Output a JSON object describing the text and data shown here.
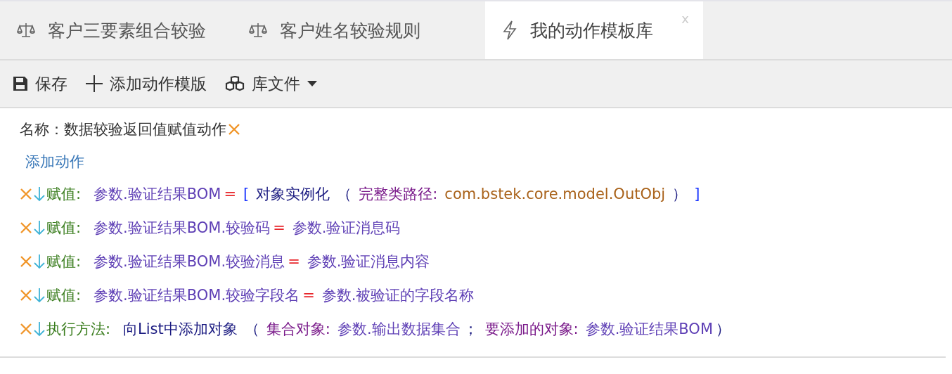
{
  "tabs": [
    {
      "kind": "scale",
      "label": "客户三要素组合较验",
      "selected": false
    },
    {
      "kind": "scale",
      "label": "客户姓名较验规则",
      "selected": false
    },
    {
      "kind": "bolt",
      "label": "我的动作模板库",
      "selected": true,
      "close": "x"
    }
  ],
  "toolbar": [
    {
      "kind": "save",
      "label": "保存"
    },
    {
      "kind": "plus",
      "label": "添加动作模版"
    },
    {
      "kind": "cubes",
      "label": "库文件",
      "dropdown": true
    }
  ],
  "name": {
    "label": "名称：",
    "value": "数据较验返回值赋值动作"
  },
  "add_action": "添加动作",
  "actions": [
    {
      "tokens": [
        {
          "kind": "label",
          "text": "赋值:"
        },
        {
          "kind": "var",
          "text": "参数.验证结果BOM"
        },
        {
          "kind": "eq",
          "text": "="
        },
        {
          "kind": "bracket",
          "text": "["
        },
        {
          "kind": "method",
          "text": "对象实例化"
        },
        {
          "kind": "paren",
          "text": "（"
        },
        {
          "kind": "param",
          "text": "完整类路径:"
        },
        {
          "kind": "value",
          "text": "com.bstek.core.model.OutObj"
        },
        {
          "kind": "paren",
          "text": "）"
        },
        {
          "kind": "bracket",
          "text": "]"
        }
      ]
    },
    {
      "tokens": [
        {
          "kind": "label",
          "text": "赋值:"
        },
        {
          "kind": "var",
          "text": "参数.验证结果BOM.较验码"
        },
        {
          "kind": "eq",
          "text": "="
        },
        {
          "kind": "var",
          "text": "参数.验证消息码"
        }
      ]
    },
    {
      "tokens": [
        {
          "kind": "label",
          "text": "赋值:"
        },
        {
          "kind": "var",
          "text": "参数.验证结果BOM.较验消息"
        },
        {
          "kind": "eq",
          "text": "="
        },
        {
          "kind": "var",
          "text": "参数.验证消息内容"
        }
      ]
    },
    {
      "tokens": [
        {
          "kind": "label",
          "text": "赋值:"
        },
        {
          "kind": "var",
          "text": "参数.验证结果BOM.较验字段名"
        },
        {
          "kind": "eq",
          "text": "="
        },
        {
          "kind": "var",
          "text": "参数.被验证的字段名称"
        }
      ]
    },
    {
      "tokens": [
        {
          "kind": "label",
          "text": "执行方法:"
        },
        {
          "kind": "method",
          "text": "向List中添加对象"
        },
        {
          "kind": "paren",
          "text": "（"
        },
        {
          "kind": "param",
          "text": "集合对象:"
        },
        {
          "kind": "var",
          "text": "参数.输出数据集合"
        },
        {
          "kind": "paren",
          "text": "；"
        },
        {
          "kind": "param",
          "text": "要添加的对象:"
        },
        {
          "kind": "var",
          "text": "参数.验证结果BOM"
        },
        {
          "kind": "paren",
          "text": "）"
        }
      ]
    }
  ]
}
